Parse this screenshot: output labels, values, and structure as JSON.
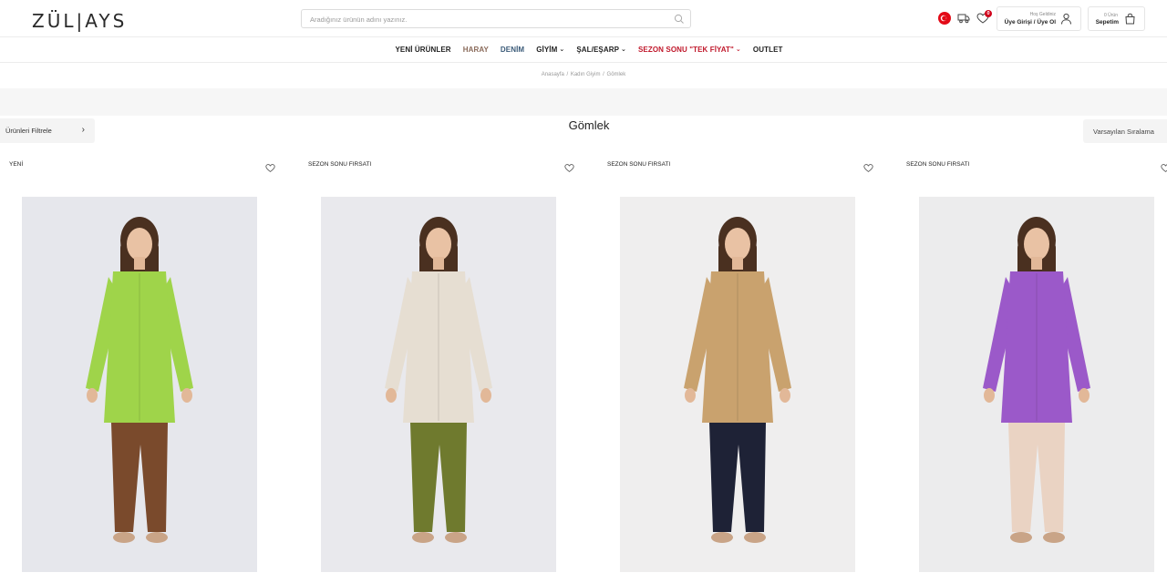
{
  "brand": {
    "logo_text": "ZÜL|AYS"
  },
  "search": {
    "placeholder": "Aradığınız ürünün adını yazınız."
  },
  "header": {
    "favorites_count": "0",
    "account": {
      "greeting": "Hoş Geldiniz",
      "label": "Üye Girişi / Üye Ol"
    },
    "cart": {
      "count_text": "0 Ürün",
      "label": "Sepetim"
    },
    "icons": [
      "turkey-flag-icon",
      "truck-icon",
      "heart-icon",
      "user-icon",
      "bag-icon",
      "search-icon"
    ]
  },
  "nav": {
    "items": [
      {
        "label": "YENİ ÜRÜNLER"
      },
      {
        "label": "HARAY"
      },
      {
        "label": "DENİM"
      },
      {
        "label": "GİYİM"
      },
      {
        "label": "ŞAL/EŞARP"
      },
      {
        "label": "SEZON SONU \"TEK FİYAT\""
      },
      {
        "label": "OUTLET"
      }
    ]
  },
  "breadcrumb": [
    "Anasayfa",
    "Kadın Giyim",
    "Gömlek"
  ],
  "toolbar": {
    "filter_label": "Ürünleri Filtrele",
    "sort_label": "Varsayılan Sıralama"
  },
  "page": {
    "title": "Gömlek"
  },
  "products": [
    {
      "tag": "YENİ",
      "top_color": "#9fd44a",
      "pants_color": "#7a4a2c"
    },
    {
      "tag": "SEZON SONU FIRSATI",
      "top_color": "#e6ded2",
      "pants_color": "#6f7a2e"
    },
    {
      "tag": "SEZON SONU FIRSATI",
      "top_color": "#c9a26e",
      "pants_color": "#1e2236"
    },
    {
      "tag": "SEZON SONU FIRSATI",
      "top_color": "#9b59c9",
      "pants_color": "#ead3c3"
    }
  ],
  "colors": {
    "sale": "#c0182b",
    "haray": "#8a6a5a",
    "denim": "#3a5a78",
    "badge": "#d0021b"
  }
}
